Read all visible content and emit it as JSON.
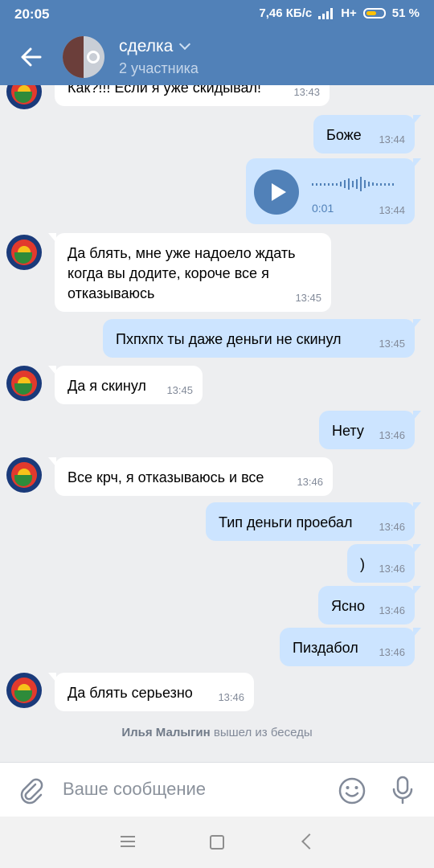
{
  "status_bar": {
    "time": "20:05",
    "speed": "7,46 КБ/с",
    "network": "H+",
    "battery": "51 %"
  },
  "header": {
    "title": "сделка",
    "subtitle": "2 участника"
  },
  "messages": [
    {
      "dir": "in",
      "text": "Как?!!! Если я уже скидывал!",
      "time": "13:43"
    },
    {
      "dir": "out",
      "text": "Боже",
      "time": "13:44"
    },
    {
      "dir": "out",
      "type": "voice",
      "duration": "0:01",
      "time": "13:44"
    },
    {
      "dir": "in",
      "text": "Да блять, мне уже надоело ждать когда вы додите, короче все я отказываюсь",
      "time": "13:45"
    },
    {
      "dir": "out",
      "text": "Пхпхпх ты даже деньги не скинул",
      "time": "13:45"
    },
    {
      "dir": "in",
      "text": "Да я скинул",
      "time": "13:45"
    },
    {
      "dir": "out",
      "text": "Нету",
      "time": "13:46"
    },
    {
      "dir": "in",
      "text": "Все крч, я отказываюсь и все",
      "time": "13:46"
    },
    {
      "dir": "out",
      "text": "Тип деньги проебал",
      "time": "13:46"
    },
    {
      "dir": "out",
      "text": ")",
      "time": "13:46"
    },
    {
      "dir": "out",
      "text": "Ясно",
      "time": "13:46"
    },
    {
      "dir": "out",
      "text": "Пиздабол",
      "time": "13:46"
    },
    {
      "dir": "in",
      "text": "Да блять серьезно",
      "time": "13:46"
    }
  ],
  "system_message": {
    "name": "Илья Малыгин",
    "text": "вышел из беседы"
  },
  "composer": {
    "placeholder": "Ваше сообщение"
  },
  "colors": {
    "header": "#5181b8",
    "outgoing_bubble": "#cce4ff",
    "incoming_bubble": "#ffffff",
    "background": "#edeef0"
  },
  "icons": [
    "back-arrow-icon",
    "signal-icon",
    "battery-icon",
    "play-icon",
    "attach-icon",
    "smile-icon",
    "mic-icon",
    "menu-icon",
    "home-icon",
    "nav-back-icon"
  ]
}
